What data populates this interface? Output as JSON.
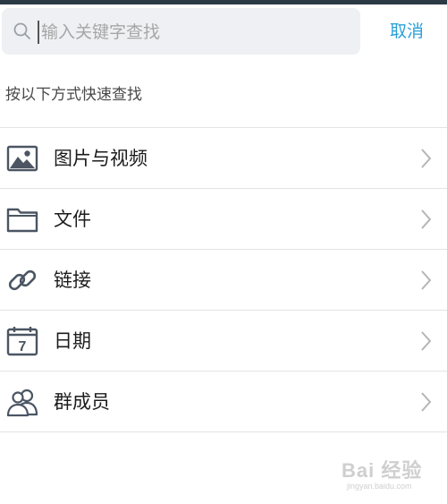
{
  "search": {
    "placeholder": "输入关键字查找",
    "cancel_label": "取消"
  },
  "hint": "按以下方式快速查找",
  "items": [
    {
      "label": "图片与视频",
      "icon": "image-icon"
    },
    {
      "label": "文件",
      "icon": "folder-icon"
    },
    {
      "label": "链接",
      "icon": "link-icon"
    },
    {
      "label": "日期",
      "icon": "calendar-icon",
      "badge": "7"
    },
    {
      "label": "群成员",
      "icon": "group-members-icon"
    }
  ],
  "colors": {
    "accent": "#2aa0d8",
    "icon": "#4b5563",
    "search_bg": "#eff0f4",
    "divider": "#e3e3e3"
  },
  "watermark": {
    "main": "Bai 经验",
    "sub": "jingyan.baidu.com"
  }
}
